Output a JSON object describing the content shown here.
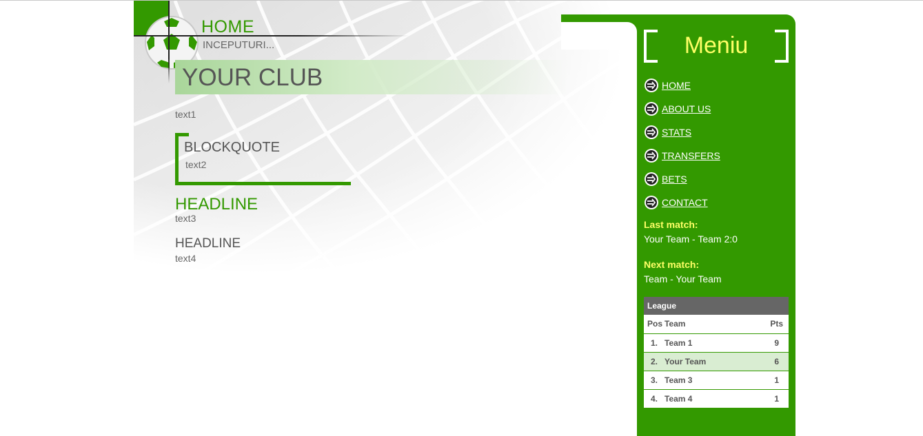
{
  "header": {
    "home_title": "HOME",
    "home_subtitle": "INCEPUTURI..."
  },
  "main": {
    "club_title": "YOUR CLUB",
    "text1": "text1",
    "blockquote": {
      "title": "BLOCKQUOTE",
      "text": "text2"
    },
    "headline1": {
      "title": "HEADLINE",
      "text": "text3"
    },
    "headline2": {
      "title": "HEADLINE",
      "text": "text4"
    }
  },
  "sidebar": {
    "menu_title": "Meniu",
    "nav": [
      {
        "label": "HOME",
        "icon": "arrow-circle-icon"
      },
      {
        "label": "ABOUT US",
        "icon": "arrow-circle-icon"
      },
      {
        "label": "STATS",
        "icon": "arrow-circle-icon"
      },
      {
        "label": "TRANSFERS",
        "icon": "arrow-circle-icon"
      },
      {
        "label": "BETS",
        "icon": "arrow-circle-icon"
      },
      {
        "label": "CONTACT",
        "icon": "arrow-circle-icon"
      }
    ],
    "last_match": {
      "label": "Last match:",
      "text": "Your Team - Team 2:0"
    },
    "next_match": {
      "label": "Next match:",
      "text": "Team - Your Team"
    },
    "league": {
      "title": "League",
      "columns": {
        "pos": "Pos",
        "team": "Team",
        "pts": "Pts"
      },
      "rows": [
        {
          "pos": "1.",
          "team": "Team 1",
          "pts": "9"
        },
        {
          "pos": "2.",
          "team": "Your Team",
          "pts": "6"
        },
        {
          "pos": "3.",
          "team": "Team 3",
          "pts": "1"
        },
        {
          "pos": "4.",
          "team": "Team 4",
          "pts": "1"
        }
      ]
    }
  },
  "colors": {
    "brand_green": "#339900",
    "menu_yellow": "#ffff66",
    "league_header_gray": "#666666",
    "highlight_row": "#d9edd2"
  }
}
